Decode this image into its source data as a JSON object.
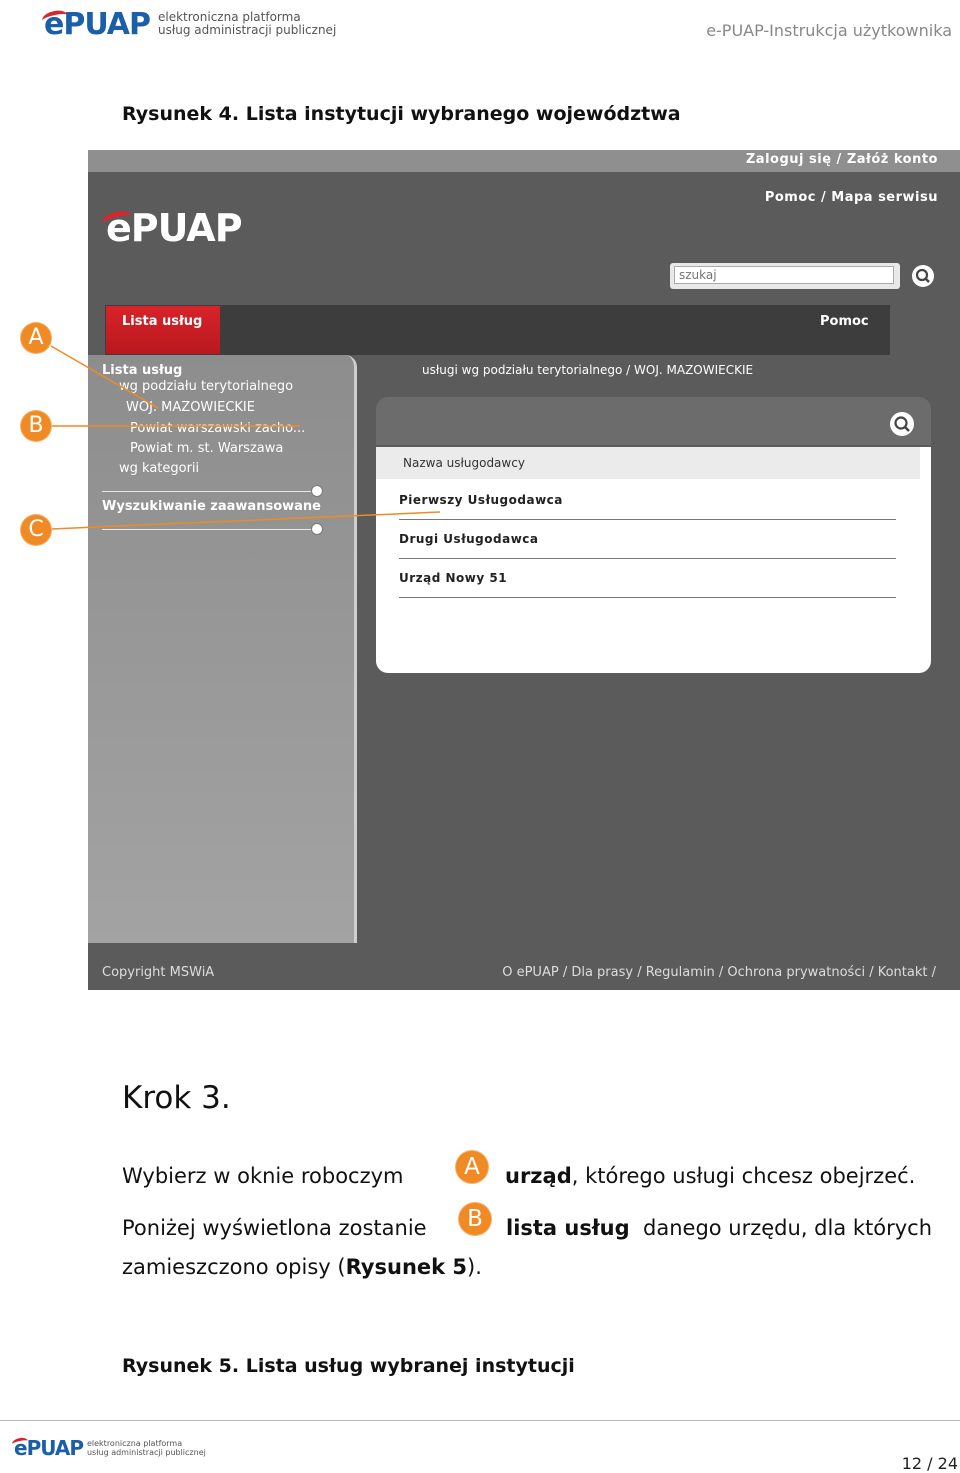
{
  "header": {
    "logo_text": "ePUAP",
    "logo_tagline_1": "elektroniczna platforma",
    "logo_tagline_2": "usług administracji publicznej",
    "doc_title": "e-PUAP-Instrukcja użytkownika"
  },
  "figure4": {
    "caption": "Rysunek 4. Lista instytucji wybranego województwa",
    "screenshot": {
      "top_links": "Zaloguj się  /  Załóż konto",
      "links2": "Pomoc / Mapa serwisu",
      "logo": "ePUAP",
      "search_placeholder": "szukaj",
      "nav_tab": "Lista usług",
      "nav_help": "Pomoc",
      "sidebar": {
        "title": "Lista usług",
        "item1": "wg podziału terytorialnego",
        "item2": "WOJ. MAZOWIECKIE",
        "item3": "Powiat warszawski zacho...",
        "item4": "Powiat m. st. Warszawa",
        "item5": "wg kategorii",
        "advanced": "Wyszukiwanie zaawansowane"
      },
      "breadcrumb": "usługi wg podziału terytorialnego / WOJ. MAZOWIECKIE",
      "column_header": "Nazwa usługodawcy",
      "rows": [
        "Pierwszy Usługodawca",
        "Drugi Usługodawca",
        "Urząd Nowy 51"
      ],
      "footer_left": "Copyright MSWiA",
      "footer_right": "O ePUAP / Dla prasy / Regulamin / Ochrona prywatności / Kontakt /"
    },
    "callouts": {
      "a": "A",
      "b": "B",
      "c": "C"
    }
  },
  "step": {
    "title": "Krok 3.",
    "line1_pre": "Wybierz  w  oknie  roboczym",
    "line1_badge": "A",
    "line1_bold": "urząd",
    "line1_post": ",  którego  usługi  chcesz  obejrzeć.",
    "line2_pre": "Poniżej  wyświetlona  zostanie",
    "line2_badge": "B",
    "line2_bold": "lista  usług",
    "line2_post": "danego  urzędu,  dla  których",
    "line3_pre": "zamieszczono opisy (",
    "line3_bold": "Rysunek 5",
    "line3_post": ")."
  },
  "figure5": {
    "caption": "Rysunek 5. Lista usług wybranej instytucji"
  },
  "footer": {
    "logo_text": "ePUAP",
    "tagline_1": "elektroniczna platforma",
    "tagline_2": "usług administracji publicznej",
    "page": "12 / 24"
  },
  "colors": {
    "accent_red": "#d8262c",
    "brand_blue": "#1b5fa8",
    "callout_orange": "#f08a24"
  }
}
